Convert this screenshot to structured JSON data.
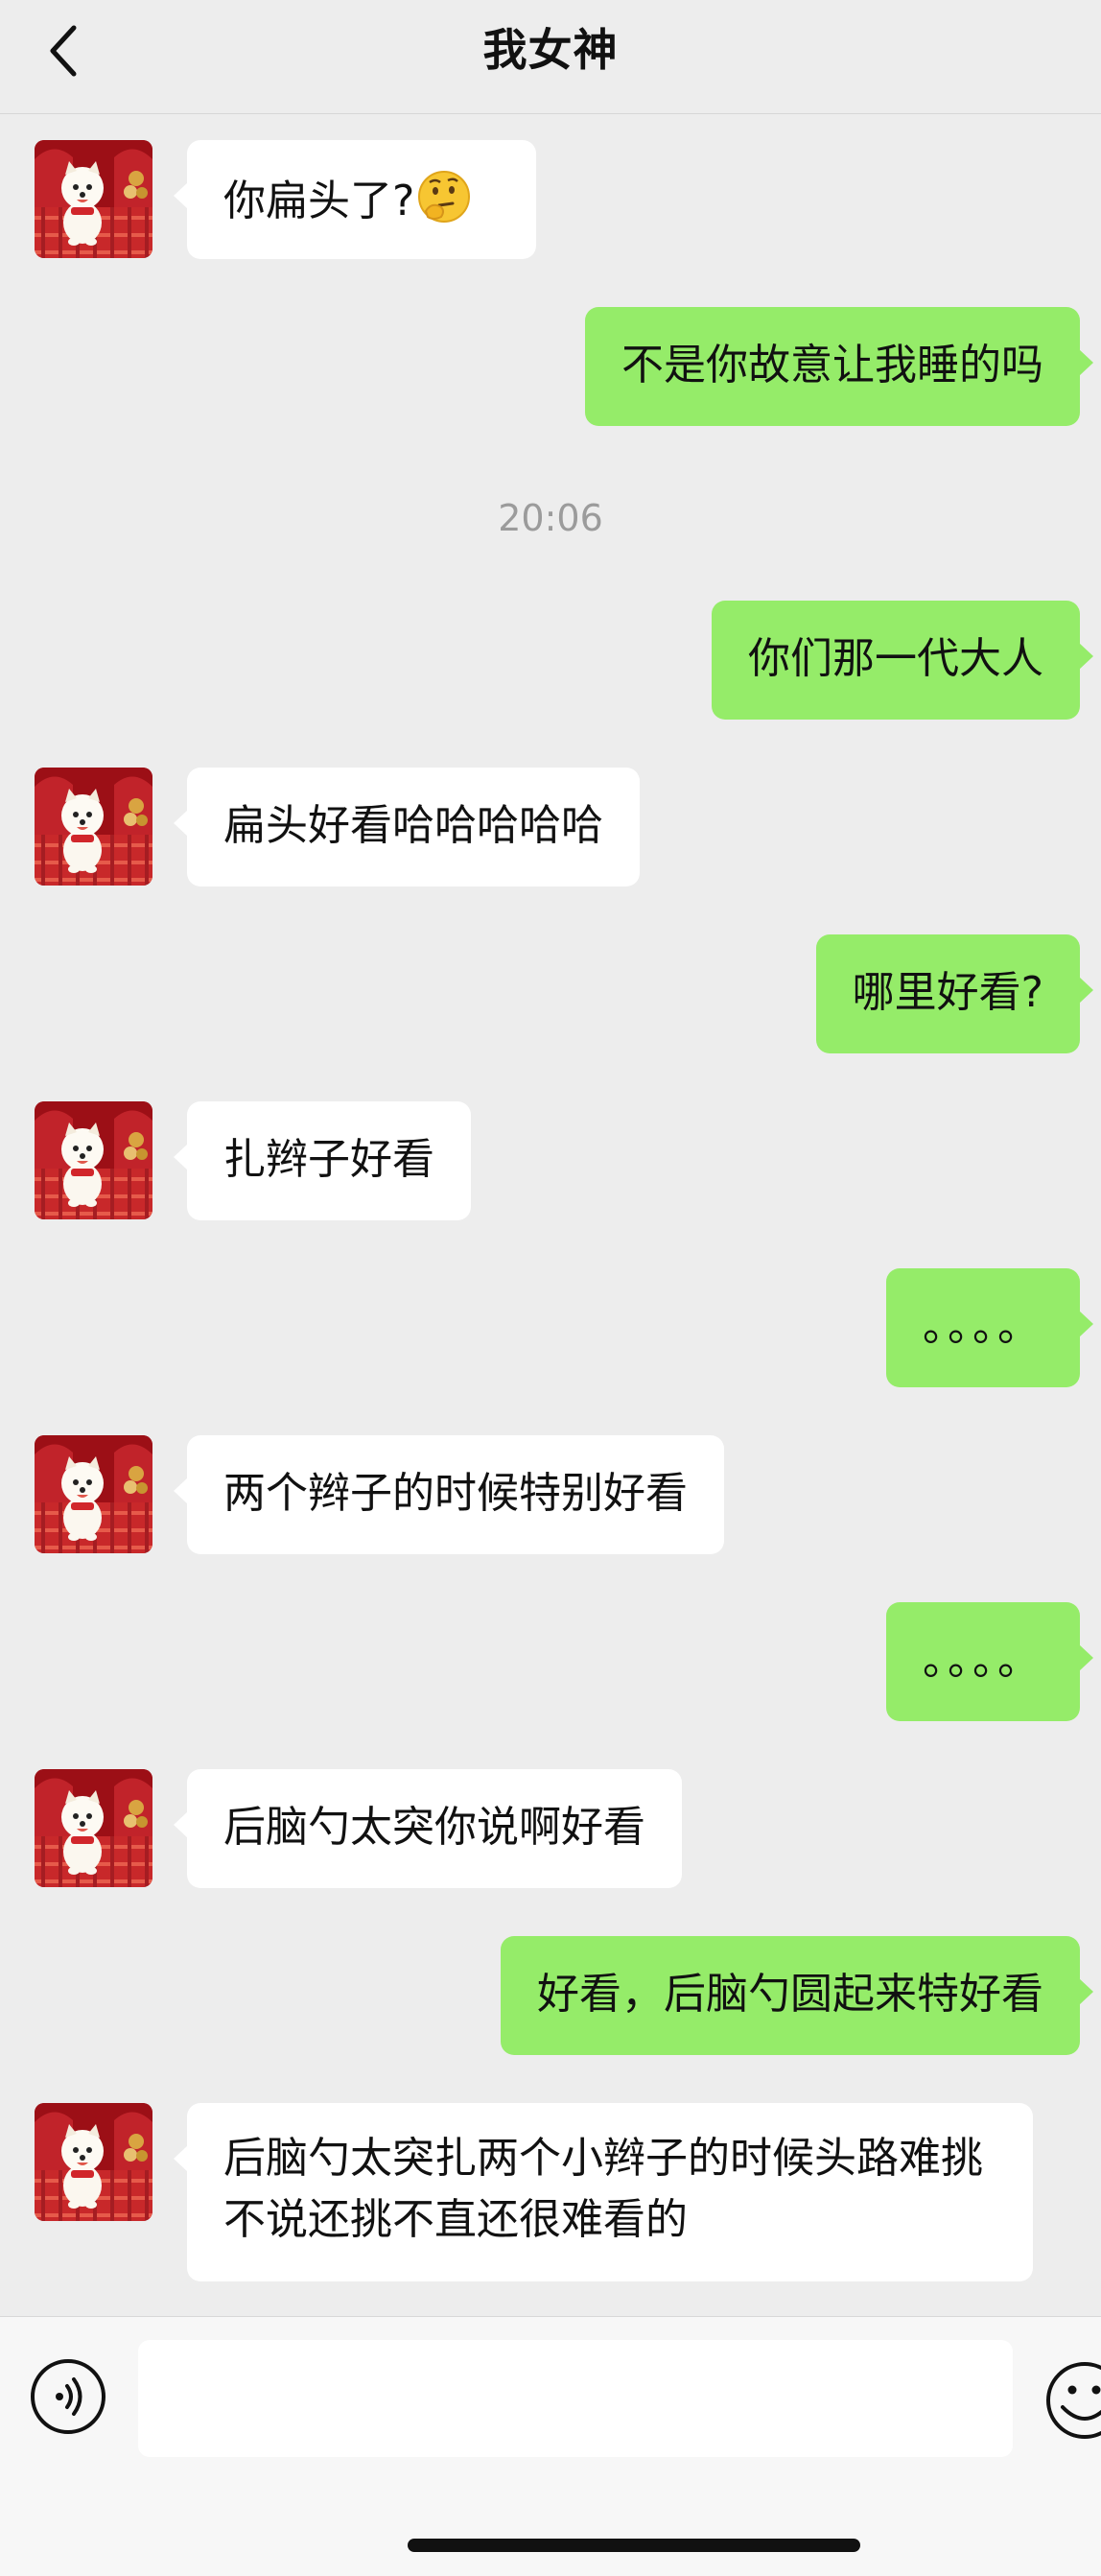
{
  "header": {
    "title": "我女神"
  },
  "timestamp": "20:06",
  "messages": [
    {
      "side": "left",
      "text": "你扁头了?"
    },
    {
      "side": "right",
      "text": "不是你故意让我睡的吗"
    },
    {
      "side": "right",
      "text": "你们那一代大人"
    },
    {
      "side": "left",
      "text": "扁头好看哈哈哈哈哈"
    },
    {
      "side": "right",
      "text": "哪里好看?"
    },
    {
      "side": "left",
      "text": "扎辫子好看"
    },
    {
      "side": "right",
      "text": "。。。。"
    },
    {
      "side": "left",
      "text": "两个辫子的时候特别好看"
    },
    {
      "side": "right",
      "text": "。。。。"
    },
    {
      "side": "left",
      "text": "后脑勺太突你说啊好看"
    },
    {
      "side": "right",
      "text": "好看，后脑勺圆起来特好看"
    },
    {
      "side": "left",
      "text": "后脑勺太突扎两个小辫子的时候头路难挑不说还挑不直还很难看的"
    }
  ],
  "icons": {
    "back": "chevron-left-icon",
    "voice": "voice-icon",
    "emoji": "smiley-icon",
    "thinking_emoji": "thinking-face-emoji"
  },
  "colors": {
    "background": "#ededed",
    "own_bubble": "#95ec69",
    "other_bubble": "#ffffff",
    "timestamp": "#9b9b9b"
  }
}
